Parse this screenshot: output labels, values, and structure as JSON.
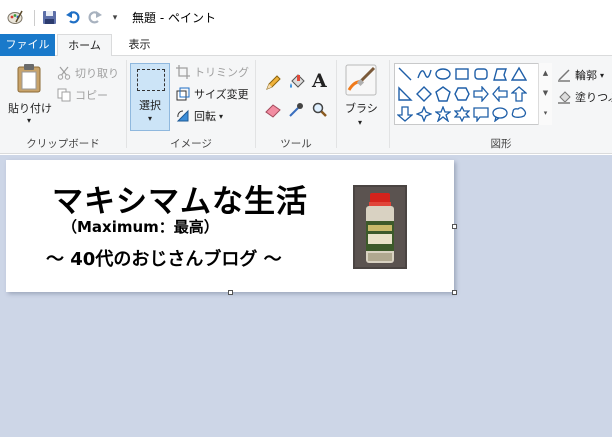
{
  "window": {
    "title": "無題 - ペイント"
  },
  "tabs": [
    {
      "label": "ファイル"
    },
    {
      "label": "ホーム"
    },
    {
      "label": "表示"
    }
  ],
  "ribbon": {
    "clipboard": {
      "paste_label": "貼り付け",
      "cut_label": "切り取り",
      "copy_label": "コピー",
      "group_label": "クリップボード"
    },
    "image": {
      "select_label": "選択",
      "crop_label": "トリミング",
      "resize_label": "サイズ変更",
      "rotate_label": "回転",
      "group_label": "イメージ"
    },
    "tools": {
      "group_label": "ツール"
    },
    "brushes": {
      "label": "ブラシ"
    },
    "shapes": {
      "outline_label": "輪郭",
      "fill_label": "塗りつぶ",
      "group_label": "図形"
    }
  },
  "canvas_content": {
    "title": "マキシマムな生活",
    "subtitle": "（Maximum：最高）",
    "tagline": "～ 40代のおじさんブログ ～"
  },
  "colors": {
    "file_tab": "#1979ca",
    "ribbon_bg": "#f5f6f7",
    "workspace_bg": "#cdd6e7",
    "select_highlight": "#cce4f7"
  }
}
